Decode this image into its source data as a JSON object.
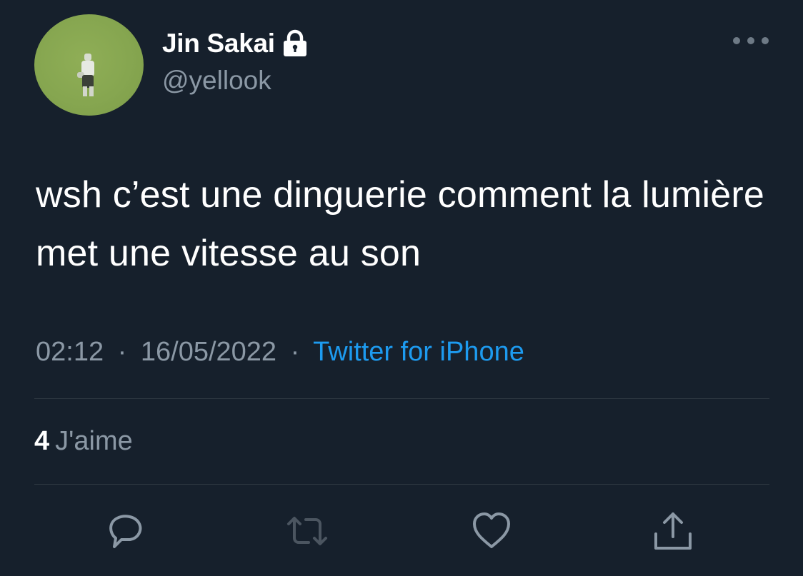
{
  "author": {
    "display_name": "Jin Sakai",
    "handle": "@yellook",
    "protected_icon": "lock-icon"
  },
  "tweet": {
    "text": "wsh c’est une dinguerie comment la lumière met une vitesse au son",
    "time": "02:12",
    "date": "16/05/2022",
    "separator": "·",
    "source": "Twitter for iPhone"
  },
  "stats": {
    "likes_count": "4",
    "likes_label": "J'aime"
  },
  "actions": [
    {
      "name": "reply",
      "icon": "reply-icon"
    },
    {
      "name": "retweet",
      "icon": "retweet-icon"
    },
    {
      "name": "like",
      "icon": "heart-icon"
    },
    {
      "name": "share",
      "icon": "share-icon"
    }
  ],
  "colors": {
    "background": "#16202c",
    "text_primary": "#ffffff",
    "text_secondary": "#8b98a5",
    "link": "#1d9bf0",
    "divider": "#2f3942",
    "icon": "#8b98a5",
    "avatar_green": "#86a650"
  }
}
